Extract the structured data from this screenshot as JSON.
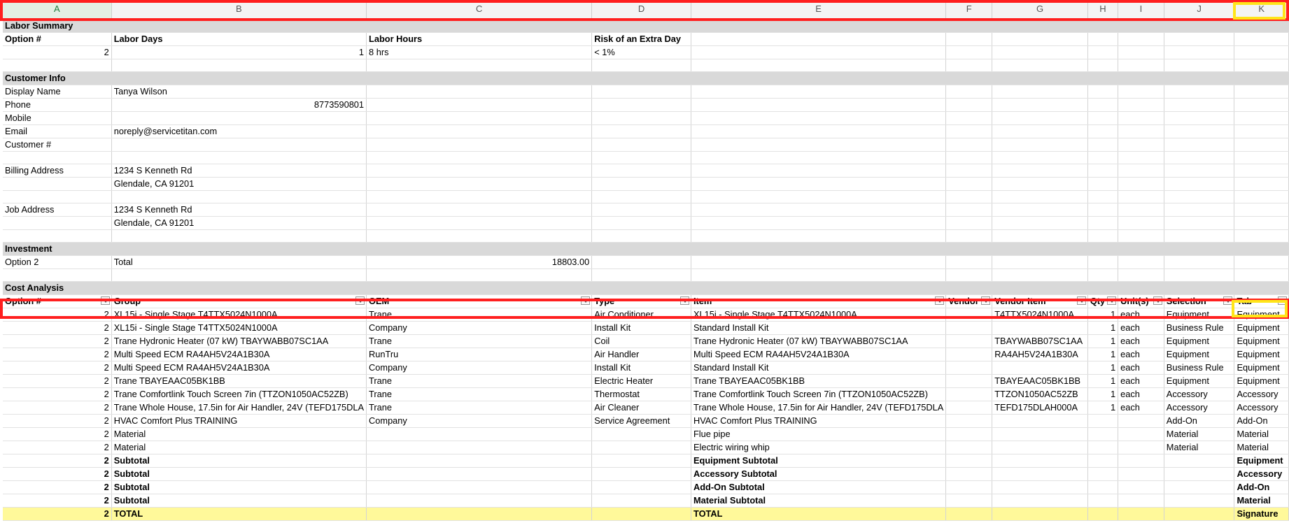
{
  "columns": [
    "A",
    "B",
    "C",
    "D",
    "E",
    "F",
    "G",
    "H",
    "I",
    "J",
    "K"
  ],
  "labor_summary": {
    "section": "Labor Summary",
    "headers": [
      "Option #",
      "Labor Days",
      "Labor Hours",
      "Risk of an Extra Day"
    ],
    "values": [
      "2",
      "1",
      "8 hrs",
      "< 1%"
    ]
  },
  "customer_info": {
    "section": "Customer Info",
    "display_name_label": "Display Name",
    "display_name": "Tanya Wilson",
    "phone_label": "Phone",
    "phone": "8773590801",
    "mobile_label": "Mobile",
    "email_label": "Email",
    "email": "noreply@servicetitan.com",
    "customer_no_label": "Customer #",
    "billing_label": "Billing Address",
    "billing_line1": "1234 S Kenneth Rd",
    "billing_line2": "Glendale, CA 91201",
    "job_label": "Job Address",
    "job_line1": "1234 S Kenneth Rd",
    "job_line2": "Glendale, CA 91201"
  },
  "investment": {
    "section": "Investment",
    "option": "Option 2",
    "label": "Total",
    "amount": "18803.00"
  },
  "cost_analysis": {
    "section": "Cost Analysis",
    "headers": [
      "Option #",
      "Group",
      "OEM",
      "Type",
      "Item",
      "Vendor",
      "Vendor Item",
      "Qty",
      "Unit(s)",
      "Selection",
      "Tab"
    ],
    "rows": [
      [
        "2",
        "XL15i - Single Stage T4TTX5024N1000A",
        "Trane",
        "Air Conditioner",
        "XL15i - Single Stage T4TTX5024N1000A",
        "",
        "T4TTX5024N1000A",
        "1",
        "each",
        "Equipment",
        "Equipment"
      ],
      [
        "2",
        "XL15i - Single Stage T4TTX5024N1000A",
        "Company",
        "Install Kit",
        "Standard Install Kit",
        "",
        "",
        "1",
        "each",
        "Business Rule",
        "Equipment"
      ],
      [
        "2",
        "Trane Hydronic Heater (07 kW) TBAYWABB07SC1AA",
        "Trane",
        "Coil",
        "Trane Hydronic Heater (07 kW) TBAYWABB07SC1AA",
        "",
        "TBAYWABB07SC1AA",
        "1",
        "each",
        "Equipment",
        "Equipment"
      ],
      [
        "2",
        "Multi Speed ECM RA4AH5V24A1B30A",
        "RunTru",
        "Air Handler",
        "Multi Speed ECM RA4AH5V24A1B30A",
        "",
        "RA4AH5V24A1B30A",
        "1",
        "each",
        "Equipment",
        "Equipment"
      ],
      [
        "2",
        "Multi Speed ECM RA4AH5V24A1B30A",
        "Company",
        "Install Kit",
        "Standard Install Kit",
        "",
        "",
        "1",
        "each",
        "Business Rule",
        "Equipment"
      ],
      [
        "2",
        "Trane TBAYEAAC05BK1BB",
        "Trane",
        "Electric Heater",
        "Trane TBAYEAAC05BK1BB",
        "",
        "TBAYEAAC05BK1BB",
        "1",
        "each",
        "Equipment",
        "Equipment"
      ],
      [
        "2",
        "Trane Comfortlink Touch Screen 7in (TTZON1050AC52ZB)",
        "Trane",
        "Thermostat",
        "Trane Comfortlink Touch Screen 7in (TTZON1050AC52ZB)",
        "",
        "TTZON1050AC52ZB",
        "1",
        "each",
        "Accessory",
        "Accessory"
      ],
      [
        "2",
        "Trane Whole House, 17.5in for Air Handler, 24V (TEFD175DLA",
        "Trane",
        "Air Cleaner",
        "Trane Whole House, 17.5in for Air Handler, 24V (TEFD175DLA",
        "",
        "TEFD175DLAH000A",
        "1",
        "each",
        "Accessory",
        "Accessory"
      ],
      [
        "2",
        "HVAC Comfort Plus TRAINING",
        "Company",
        "Service Agreement",
        "HVAC Comfort Plus TRAINING",
        "",
        "",
        "",
        "",
        "Add-On",
        "Add-On"
      ],
      [
        "2",
        "Material",
        "",
        "",
        "Flue pipe",
        "",
        "",
        "",
        "",
        "Material",
        "Material"
      ],
      [
        "2",
        "Material",
        "",
        "",
        "Electric wiring whip",
        "",
        "",
        "",
        "",
        "Material",
        "Material"
      ]
    ],
    "subtotals": [
      [
        "2",
        "Subtotal",
        "",
        "",
        "Equipment Subtotal",
        "",
        "",
        "",
        "",
        "",
        "Equipment"
      ],
      [
        "2",
        "Subtotal",
        "",
        "",
        "Accessory Subtotal",
        "",
        "",
        "",
        "",
        "",
        "Accessory"
      ],
      [
        "2",
        "Subtotal",
        "",
        "",
        "Add-On Subtotal",
        "",
        "",
        "",
        "",
        "",
        "Add-On"
      ],
      [
        "2",
        "Subtotal",
        "",
        "",
        "Material Subtotal",
        "",
        "",
        "",
        "",
        "",
        "Material"
      ]
    ],
    "total": [
      "2",
      "TOTAL",
      "",
      "",
      "TOTAL",
      "",
      "",
      "",
      "",
      "",
      "Signature"
    ]
  },
  "highlight_colors": {
    "red_box": "#ff1f1f",
    "yellow_box": "#ffe51a",
    "total_row": "#fff99a",
    "section_band": "#d9d9d9"
  }
}
